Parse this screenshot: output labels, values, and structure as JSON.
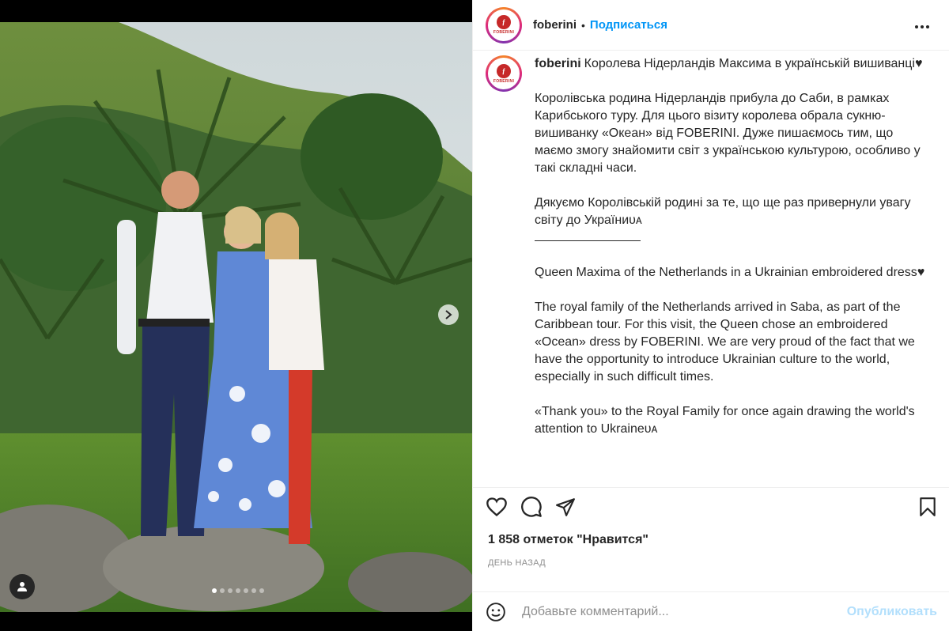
{
  "post": {
    "username": "foberini",
    "follow_label": "Подписаться",
    "more_icon": "more-horizontal-icon",
    "logo_letter": "ƒ",
    "logo_text": "FOBERINI"
  },
  "caption": {
    "first_line": "Королева Нідерландів Максима в українській вишиванці♥",
    "paragraphs": [
      "Королівська родина Нідерландів прибула до Саби, в рамках Карибського туру. Для цього візиту королева обрала сукню-вишиванку «Океан» від FOBERINI. Дуже пишаємось тим, що маємо змогу знайомити світ з українською культурою, особливо у такі складні часи.",
      "Дякуємо Королівській родині за те, що ще раз привернули увагу світу до Україниᴜᴀ",
      "Queen Maxima of the Netherlands in a Ukrainian embroidered dress♥",
      "The royal family of the Netherlands arrived in Saba, as part of the Caribbean tour. For this visit, the Queen chose an embroidered «Ocean» dress by FOBERINI. We are very proud of the fact that we have the opportunity to introduce Ukrainian culture to the world, especially in such difficult times.",
      "«Thank you» to the Royal Family for once again drawing the world's attention to Ukraineᴜᴀ"
    ]
  },
  "likes_text": "1 858 отметок \"Нравится\"",
  "time_text": "ДЕНЬ НАЗАД",
  "comment": {
    "placeholder": "Добавьте комментарий...",
    "publish_label": "Опубликовать"
  },
  "carousel": {
    "slide_count": 7,
    "active_index": 0
  }
}
